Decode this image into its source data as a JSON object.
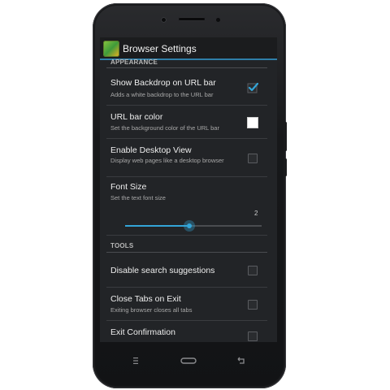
{
  "app": {
    "title": "Browser Settings"
  },
  "sections": {
    "appearance": "APPEARANCE",
    "tools": "TOOLS"
  },
  "prefs": {
    "backdrop": {
      "title": "Show Backdrop on URL bar",
      "summary": "Adds a white backdrop to the URL bar",
      "checked": true
    },
    "url_bar_color": {
      "title": "URL bar color",
      "summary": "Set the background color of the URL bar",
      "color": "#ffffff"
    },
    "desktop_view": {
      "title": "Enable Desktop View",
      "summary": "Display web pages like a desktop browser",
      "checked": false
    },
    "font_size": {
      "title": "Font Size",
      "summary": "Set the text font size",
      "value": "2",
      "fraction": 0.47
    },
    "search_suggestions": {
      "title": "Disable search suggestions",
      "checked": false
    },
    "close_tabs": {
      "title": "Close Tabs on Exit",
      "summary": "Exiting browser closes all tabs",
      "checked": false
    },
    "exit_confirm": {
      "title": "Exit Confirmation",
      "checked": false
    }
  },
  "colors": {
    "accent": "#33a5d8",
    "background": "#222427",
    "actionbar": "#1b1c1e"
  },
  "icons": {
    "app": "browser-app-icon",
    "menu": "menu-icon",
    "home": "home-icon",
    "back": "back-icon"
  }
}
